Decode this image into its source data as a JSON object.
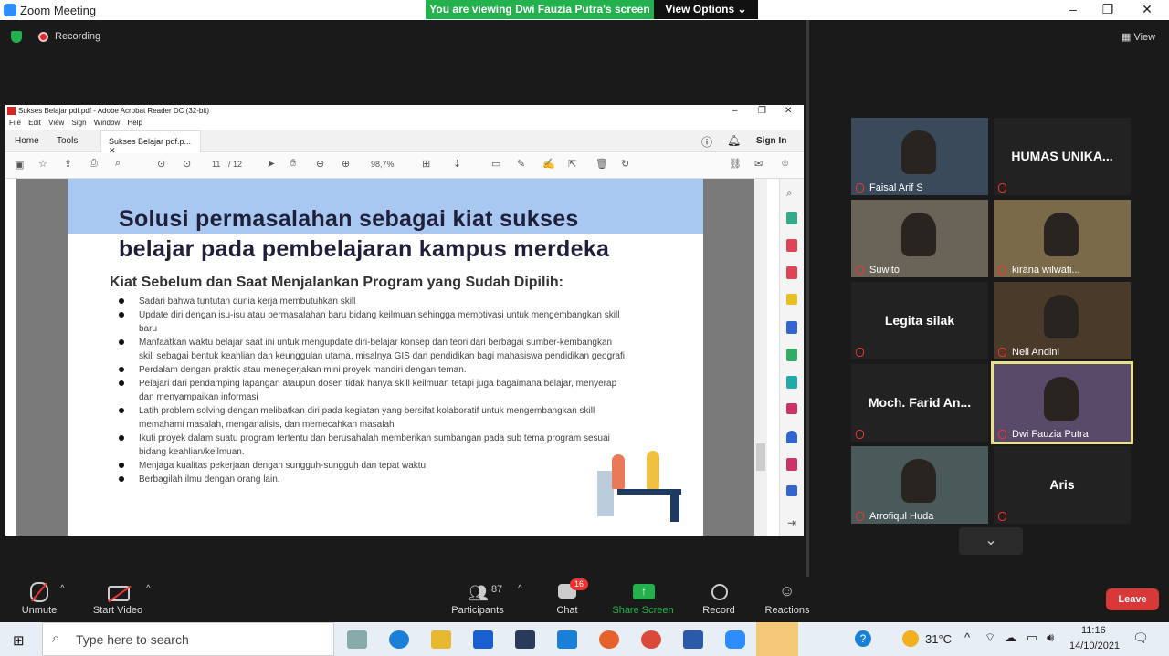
{
  "window": {
    "title": "Zoom Meeting",
    "banner": "You are viewing Dwi Fauzia Putra's screen",
    "view_options": "View Options",
    "min": "–",
    "max": "❐",
    "close": "✕"
  },
  "status": {
    "recording": "Recording",
    "view": "View"
  },
  "acrobat": {
    "title": "Sukses Belajar pdf.pdf - Adobe Acrobat Reader DC (32-bit)",
    "menu": "File Edit View Sign Window Help",
    "tab_home": "Home",
    "tab_tools": "Tools",
    "tab_doc": "Sukses Belajar pdf.p...",
    "sign_in": "Sign In",
    "page_cur": "11",
    "page_total": "/ 12",
    "zoom": "98,7%"
  },
  "slide": {
    "heading_line1": "Solusi permasalahan sebagai kiat sukses",
    "heading_line2": "belajar pada pembelajaran kampus merdeka",
    "subheading": "Kiat Sebelum dan Saat Menjalankan Program yang Sudah Dipilih:",
    "bullets": [
      "Sadari bahwa tuntutan dunia kerja membutuhkan skill",
      "Update diri dengan isu-isu atau permasalahan baru bidang keilmuan sehingga memotivasi untuk mengembangkan skill baru",
      "Manfaatkan waktu belajar saat ini untuk mengupdate diri-belajar konsep dan teori dari berbagai sumber-kembangkan skill sebagai bentuk keahlian dan keunggulan utama, misalnya GIS dan pendidikan bagi mahasiswa pendidikan geografi",
      "Perdalam dengan praktik atau menegerjakan mini proyek mandiri dengan teman.",
      "Pelajari dari pendamping lapangan ataupun dosen tidak hanya skill keilmuan tetapi juga bagaimana belajar, menyerap dan menyampaikan informasi",
      "Latih problem solving dengan melibatkan diri pada kegiatan yang bersifat kolaboratif untuk mengembangkan skill memahami masalah, menganalisis, dan memecahkan masalah",
      "Ikuti proyek dalam suatu program tertentu dan berusahalah memberikan sumbangan pada sub tema program sesuai bidang keahlian/keilmuan.",
      "Menjaga kualitas pekerjaan dengan sungguh-sungguh dan tepat waktu",
      "Berbagilah ilmu dengan orang lain."
    ]
  },
  "participants": [
    {
      "name": "Faisal Arif S",
      "label": "",
      "video": true
    },
    {
      "name": "",
      "label": "HUMAS UNIKA...",
      "video": false
    },
    {
      "name": "Suwito",
      "label": "",
      "video": true
    },
    {
      "name": "kirana wilwati...",
      "label": "",
      "video": true
    },
    {
      "name": "",
      "label": "Legita silak",
      "video": false
    },
    {
      "name": "Neli Andini",
      "label": "",
      "video": true
    },
    {
      "name": "",
      "label": "Moch. Farid An...",
      "video": false
    },
    {
      "name": "Dwi Fauzia Putra",
      "label": "",
      "video": true
    },
    {
      "name": "Arrofiqul Huda",
      "label": "",
      "video": true
    },
    {
      "name": "",
      "label": "Aris",
      "video": false
    }
  ],
  "controls": {
    "unmute": "Unmute",
    "start_video": "Start Video",
    "participants": "Participants",
    "participants_count": "87",
    "chat": "Chat",
    "chat_badge": "16",
    "share": "Share Screen",
    "record": "Record",
    "reactions": "Reactions",
    "leave": "Leave"
  },
  "taskbar": {
    "search": "Type here to search",
    "temp": "31°C",
    "time": "11:16",
    "date": "14/10/2021"
  },
  "colors": {
    "zoom_blue": "#2d8cff",
    "share_green": "#23b14d",
    "leave_red": "#d93838",
    "active_speaker": "#e6e28a"
  }
}
